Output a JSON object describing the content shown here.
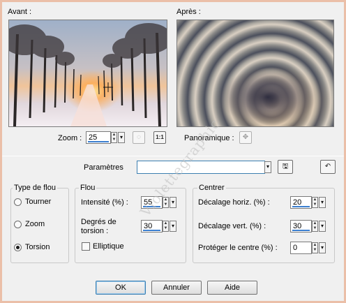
{
  "preview": {
    "before_label": "Avant :",
    "after_label": "Après :",
    "zoom_label": "Zoom :",
    "zoom_value": "25",
    "panoramique_label": "Panoramique :"
  },
  "params": {
    "label": "Paramètres",
    "value": ""
  },
  "blur_type": {
    "title": "Type de flou",
    "options": [
      "Tourner",
      "Zoom",
      "Torsion"
    ],
    "selected": "Torsion"
  },
  "flou": {
    "title": "Flou",
    "intensity_label": "Intensité (%) :",
    "intensity_value": "55",
    "torsion_label_line1": "Degrés de",
    "torsion_label_line2": "torsion :",
    "torsion_value": "30",
    "elliptique_label": "Elliptique",
    "elliptique_checked": false
  },
  "centrer": {
    "title": "Centrer",
    "horiz_label": "Décalage horiz. (%) :",
    "horiz_value": "20",
    "vert_label": "Décalage vert. (%) :",
    "vert_value": "30",
    "protect_label": "Protéger le centre (%) :",
    "protect_value": "0"
  },
  "buttons": {
    "ok": "OK",
    "cancel": "Annuler",
    "help": "Aide"
  },
  "watermark": "Violettegraphic"
}
